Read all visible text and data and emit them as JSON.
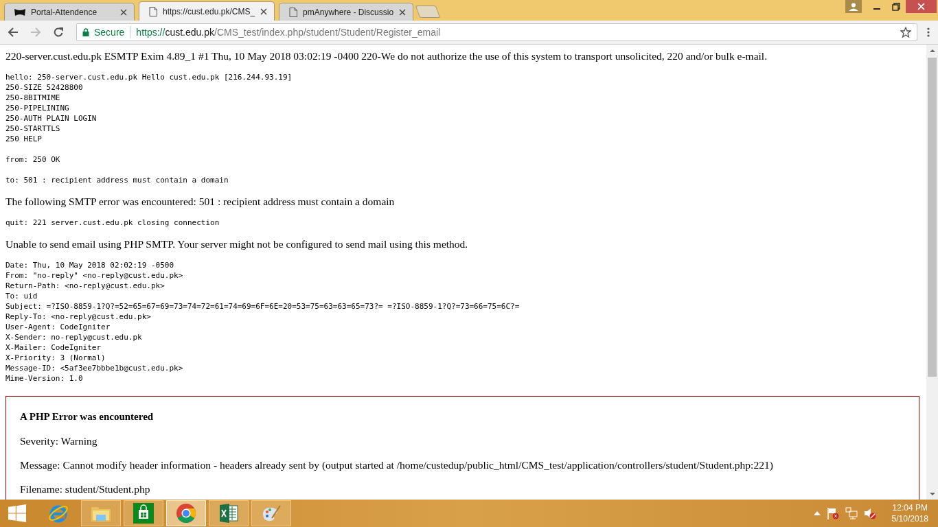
{
  "tabs": [
    {
      "title": "Portal-Attendence",
      "selected": false
    },
    {
      "title": "https://cust.edu.pk/CMS_",
      "selected": true
    },
    {
      "title": "pmAnywhere - Discussio",
      "selected": false
    }
  ],
  "address_bar": {
    "security": "Secure",
    "scheme": "https://",
    "host": "cust.edu.pk",
    "path": "/CMS_test/index.php/student/Student/Register_email"
  },
  "content": [
    {
      "kind": "serif",
      "text": "220-server.cust.edu.pk ESMTP Exim 4.89_1 #1 Thu, 10 May 2018 03:02:19 -0400 220-We do not authorize the use of this system to transport unsolicited, 220 and/or bulk e-mail."
    },
    {
      "kind": "mono",
      "lines": [
        "hello: 250-server.cust.edu.pk Hello cust.edu.pk [216.244.93.19]",
        "250-SIZE 52428800",
        "250-8BITMIME",
        "250-PIPELINING",
        "250-AUTH PLAIN LOGIN",
        "250-STARTTLS",
        "250 HELP"
      ]
    },
    {
      "kind": "mono",
      "lines": [
        "from: 250 OK"
      ]
    },
    {
      "kind": "mono",
      "lines": [
        "to: 501 : recipient address must contain a domain"
      ]
    },
    {
      "kind": "serif",
      "text": "The following SMTP error was encountered: 501 : recipient address must contain a domain"
    },
    {
      "kind": "mono",
      "lines": [
        "quit: 221 server.cust.edu.pk closing connection"
      ]
    },
    {
      "kind": "serif",
      "text": "Unable to send email using PHP SMTP. Your server might not be configured to send mail using this method."
    },
    {
      "kind": "mono",
      "lines": [
        "Date: Thu, 10 May 2018 02:02:19 -0500",
        "From: \"no-reply\" <no-reply@cust.edu.pk>",
        "Return-Path: <no-reply@cust.edu.pk>",
        "To: uid",
        "Subject: =?ISO-8859-1?Q?=52=65=67=69=73=74=72=61=74=69=6F=6E=20=53=75=63=63=65=73?= =?ISO-8859-1?Q?=73=66=75=6C?=",
        "Reply-To: <no-reply@cust.edu.pk>",
        "User-Agent: CodeIgniter",
        "X-Sender: no-reply@cust.edu.pk",
        "X-Mailer: CodeIgniter",
        "X-Priority: 3 (Normal)",
        "Message-ID: <5af3ee7bbbe1b@cust.edu.pk>",
        "Mime-Version: 1.0"
      ]
    }
  ],
  "php_error": {
    "title": "A PHP Error was encountered",
    "lines": [
      "Severity: Warning",
      "Message: Cannot modify header information - headers already sent by (output started at /home/custedup/public_html/CMS_test/application/controllers/student/Student.php:221)",
      "Filename: student/Student.php"
    ]
  },
  "taskbar": {
    "apps": [
      {
        "kind": "ie",
        "selected": false
      },
      {
        "kind": "explorer",
        "selected": false
      },
      {
        "kind": "store",
        "selected": false
      },
      {
        "kind": "chrome",
        "selected": true
      },
      {
        "kind": "excel",
        "selected": false
      },
      {
        "kind": "paint",
        "selected": false
      }
    ],
    "time": "12:04 PM",
    "date": "5/10/2018"
  }
}
